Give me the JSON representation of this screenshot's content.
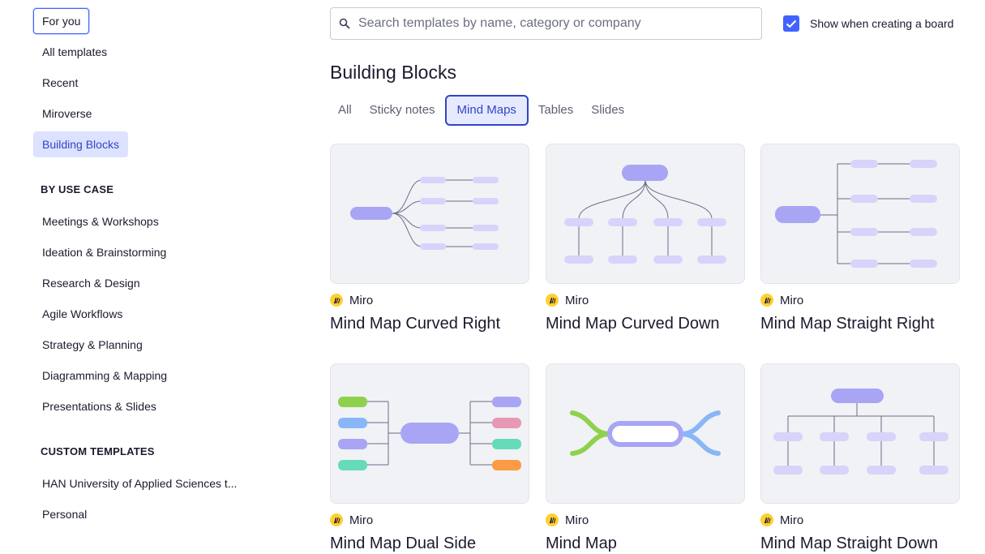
{
  "sidebar": {
    "items": [
      {
        "label": "For you"
      },
      {
        "label": "All templates"
      },
      {
        "label": "Recent"
      },
      {
        "label": "Miroverse"
      },
      {
        "label": "Building Blocks"
      }
    ],
    "use_case_title": "BY USE CASE",
    "use_cases": [
      {
        "label": "Meetings & Workshops"
      },
      {
        "label": "Ideation & Brainstorming"
      },
      {
        "label": "Research & Design"
      },
      {
        "label": "Agile Workflows"
      },
      {
        "label": "Strategy & Planning"
      },
      {
        "label": "Diagramming & Mapping"
      },
      {
        "label": "Presentations & Slides"
      }
    ],
    "custom_title": "CUSTOM TEMPLATES",
    "custom": [
      {
        "label": "HAN University of Applied Sciences t..."
      },
      {
        "label": "Personal"
      }
    ]
  },
  "search": {
    "placeholder": "Search templates by name, category or company",
    "value": ""
  },
  "show_when_creating": {
    "label": "Show when creating a board",
    "checked": true
  },
  "page_title": "Building Blocks",
  "tabs": [
    {
      "label": "All"
    },
    {
      "label": "Sticky notes"
    },
    {
      "label": "Mind Maps"
    },
    {
      "label": "Tables"
    },
    {
      "label": "Slides"
    }
  ],
  "templates": [
    {
      "author": "Miro",
      "title": "Mind Map Curved Right"
    },
    {
      "author": "Miro",
      "title": "Mind Map Curved Down"
    },
    {
      "author": "Miro",
      "title": "Mind Map Straight Right"
    },
    {
      "author": "Miro",
      "title": "Mind Map Dual Side"
    },
    {
      "author": "Miro",
      "title": "Mind Map"
    },
    {
      "author": "Miro",
      "title": "Mind Map Straight Down"
    }
  ],
  "colors": {
    "accent": "#4262ff",
    "node_primary": "#a8a5f5",
    "node_light": "#d6d4fb",
    "green": "#8fd14f",
    "blue": "#88b6f8",
    "pink": "#e698b4",
    "teal": "#67dbb8",
    "orange": "#fb9b45",
    "miro_yellow": "#ffd02f"
  }
}
